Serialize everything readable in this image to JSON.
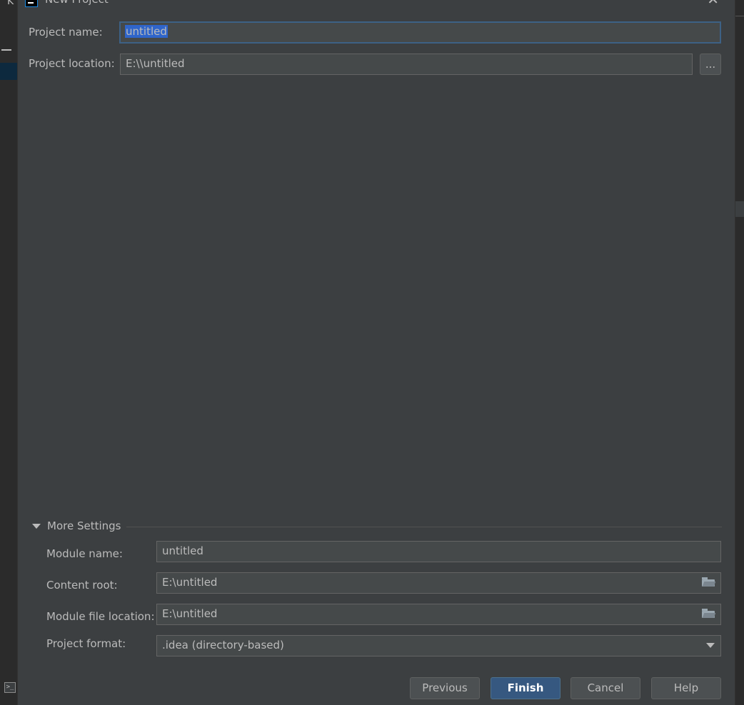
{
  "dialog": {
    "title": "New Project",
    "close_glyph": "✕"
  },
  "background": {
    "left_text": "K",
    "terminal_glyph": ">_"
  },
  "form": {
    "project_name_label": "Project name:",
    "project_name_value": "untitled",
    "project_location_label": "Project location:",
    "project_location_value": "E:\\\\untitled",
    "browse_label": "..."
  },
  "more_settings": {
    "header": "More Settings",
    "module_name_label": "Module name:",
    "module_name_value": "untitled",
    "content_root_label": "Content root:",
    "content_root_value": "E:\\untitled",
    "module_file_location_label": "Module file location:",
    "module_file_location_value": "E:\\untitled",
    "project_format_label": "Project format:",
    "project_format_value": ".idea (directory-based)"
  },
  "buttons": {
    "previous": "Previous",
    "finish": "Finish",
    "cancel": "Cancel",
    "help": "Help"
  },
  "icons": {
    "folder": "folder-icon",
    "dropdown": "chevron-down-icon",
    "expand": "triangle-down-icon",
    "close": "close-icon"
  },
  "colors": {
    "background": "#3c3f41",
    "field": "#45494a",
    "focus_border": "#3d6185",
    "selection": "#2f65ca",
    "primary_button": "#365880"
  }
}
